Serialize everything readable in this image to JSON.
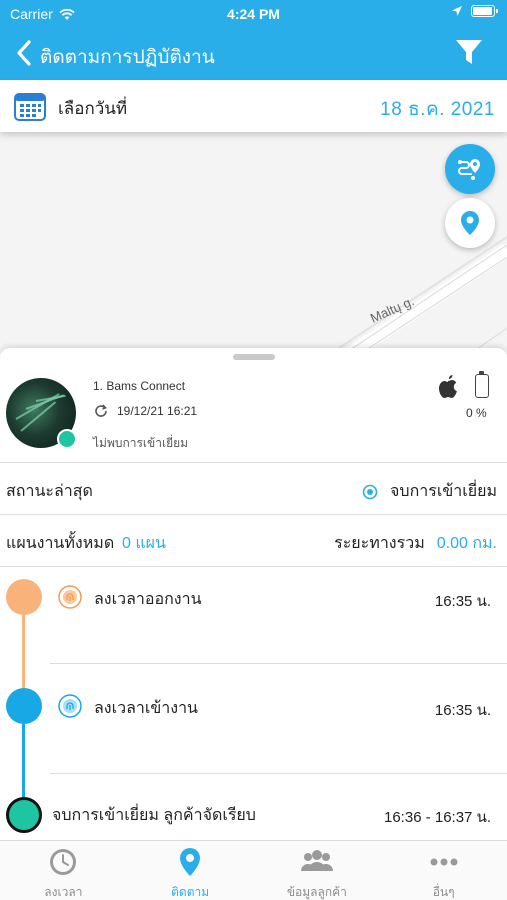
{
  "status_bar": {
    "carrier": "Carrier",
    "time": "4:24 PM"
  },
  "nav": {
    "title": "ติดตามการปฏิบัติงาน",
    "back_icon": "chevron-left-icon",
    "filter_icon": "filter-icon"
  },
  "date_bar": {
    "label": "เลือกวันที่",
    "date": "18 ธ.ค. 2021",
    "icon": "calendar-icon"
  },
  "map": {
    "street_label": "Maltų g."
  },
  "profile": {
    "name": "1. Bams Connect",
    "last_sync": "19/12/21 16:21",
    "visit_status": "ไม่พบการเข้าเยี่ยม",
    "battery_pct": "0 %",
    "platform_icon": "apple-icon"
  },
  "latest_status": {
    "label": "สถานะล่าสุด",
    "value": "จบการเข้าเยี่ยม"
  },
  "plans": {
    "label": "แผนงานทั้งหมด",
    "count": "0 แผน",
    "distance_label": "ระยะทางรวม",
    "distance": "0.00 กม."
  },
  "timeline": [
    {
      "label": "ลงเวลาออกงาน",
      "time": "16:35 น."
    },
    {
      "label": "ลงเวลาเข้างาน",
      "time": "16:35 น."
    },
    {
      "label": "จบการเข้าเยี่ยม ลูกค้าจัดเรียบ",
      "time": "16:36 - 16:37 น."
    }
  ],
  "tabs": [
    {
      "label": "ลงเวลา",
      "icon": "clock-icon"
    },
    {
      "label": "ติดตาม",
      "icon": "location-pin-icon"
    },
    {
      "label": "ข้อมูลลูกค้า",
      "icon": "customers-icon"
    },
    {
      "label": "อื่นๆ",
      "icon": "more-icon"
    }
  ],
  "colors": {
    "accent": "#2aaee9",
    "orange": "#f9b27a",
    "online": "#1fc4a0"
  }
}
